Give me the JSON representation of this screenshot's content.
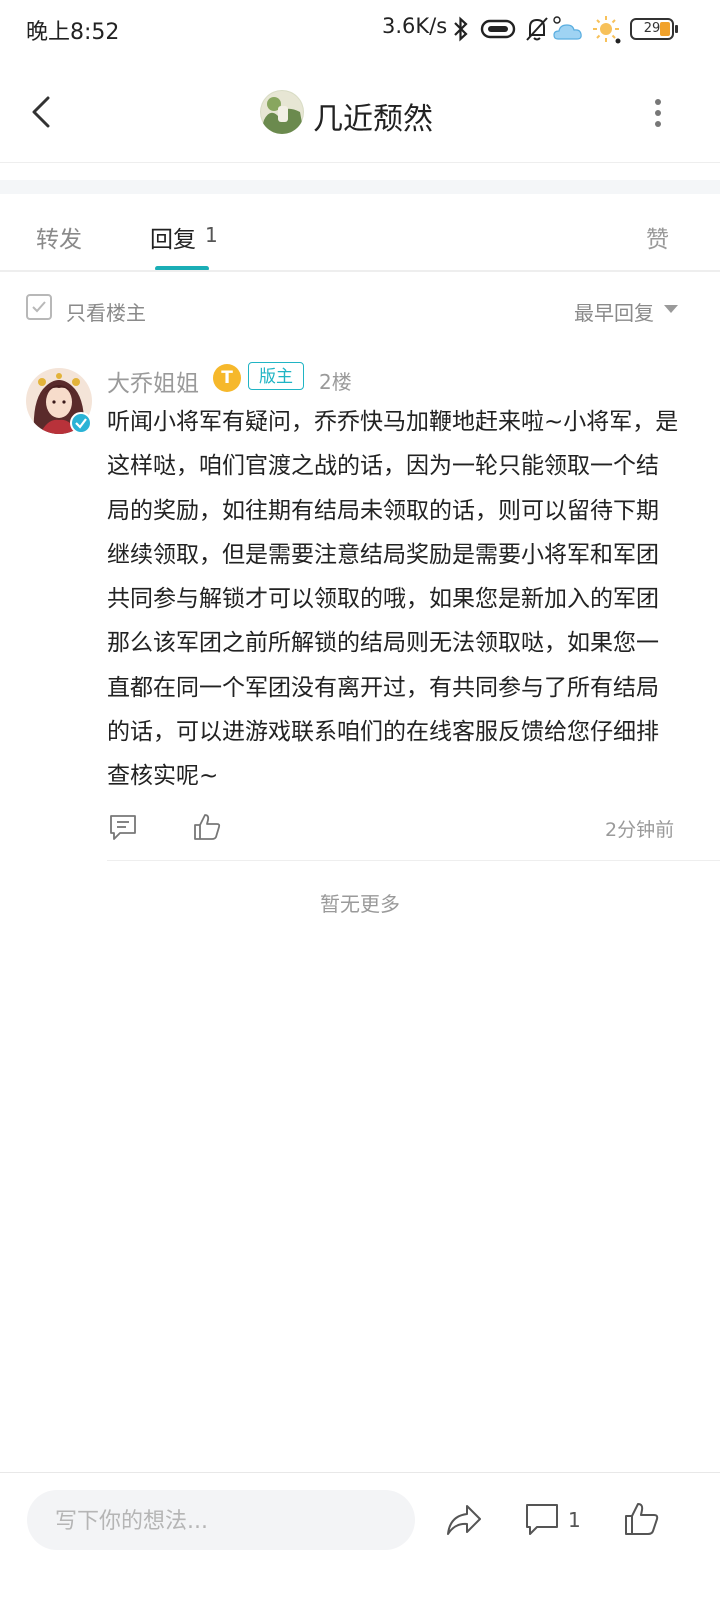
{
  "status_bar": {
    "time": "晚上8:52",
    "speed": "3.6K/s",
    "battery": "29",
    "icons": [
      "bluetooth-icon",
      "vpn-icon",
      "mute-bell-icon",
      "weather-icon",
      "brightness-icon",
      "battery-icon"
    ]
  },
  "header": {
    "title": "几近颓然"
  },
  "tabs": {
    "forward": "转发",
    "reply": "回复",
    "reply_count": "1",
    "like": "赞"
  },
  "filter": {
    "only_op_label": "只看楼主",
    "sort_label": "最早回复"
  },
  "comment": {
    "author": "大乔姐姐",
    "level_badge": "T",
    "role_badge": "版主",
    "floor": "2楼",
    "body": "听闻小将军有疑问，乔乔快马加鞭地赶来啦~小将军，是这样哒，咱们官渡之战的话，因为一轮只能领取一个结局的奖励，如往期有结局未领取的话，则可以留待下期继续领取，但是需要注意结局奖励是需要小将军和军团共同参与解锁才可以领取的哦，如果您是新加入的军团那么该军团之前所解锁的结局则无法领取哒，如果您一直都在同一个军团没有离开过，有共同参与了所有结局的话，可以进游戏联系咱们的在线客服反馈给您仔细排查核实呢~",
    "time": "2分钟前"
  },
  "no_more": "暂无更多",
  "bottom_bar": {
    "input_placeholder": "写下你的想法...",
    "comment_count": "1"
  },
  "colors": {
    "accent": "#1aaeb6",
    "role_badge": "#20b4c4",
    "level_badge": "#f6b82b",
    "battery_fill": "#f1a22b"
  }
}
